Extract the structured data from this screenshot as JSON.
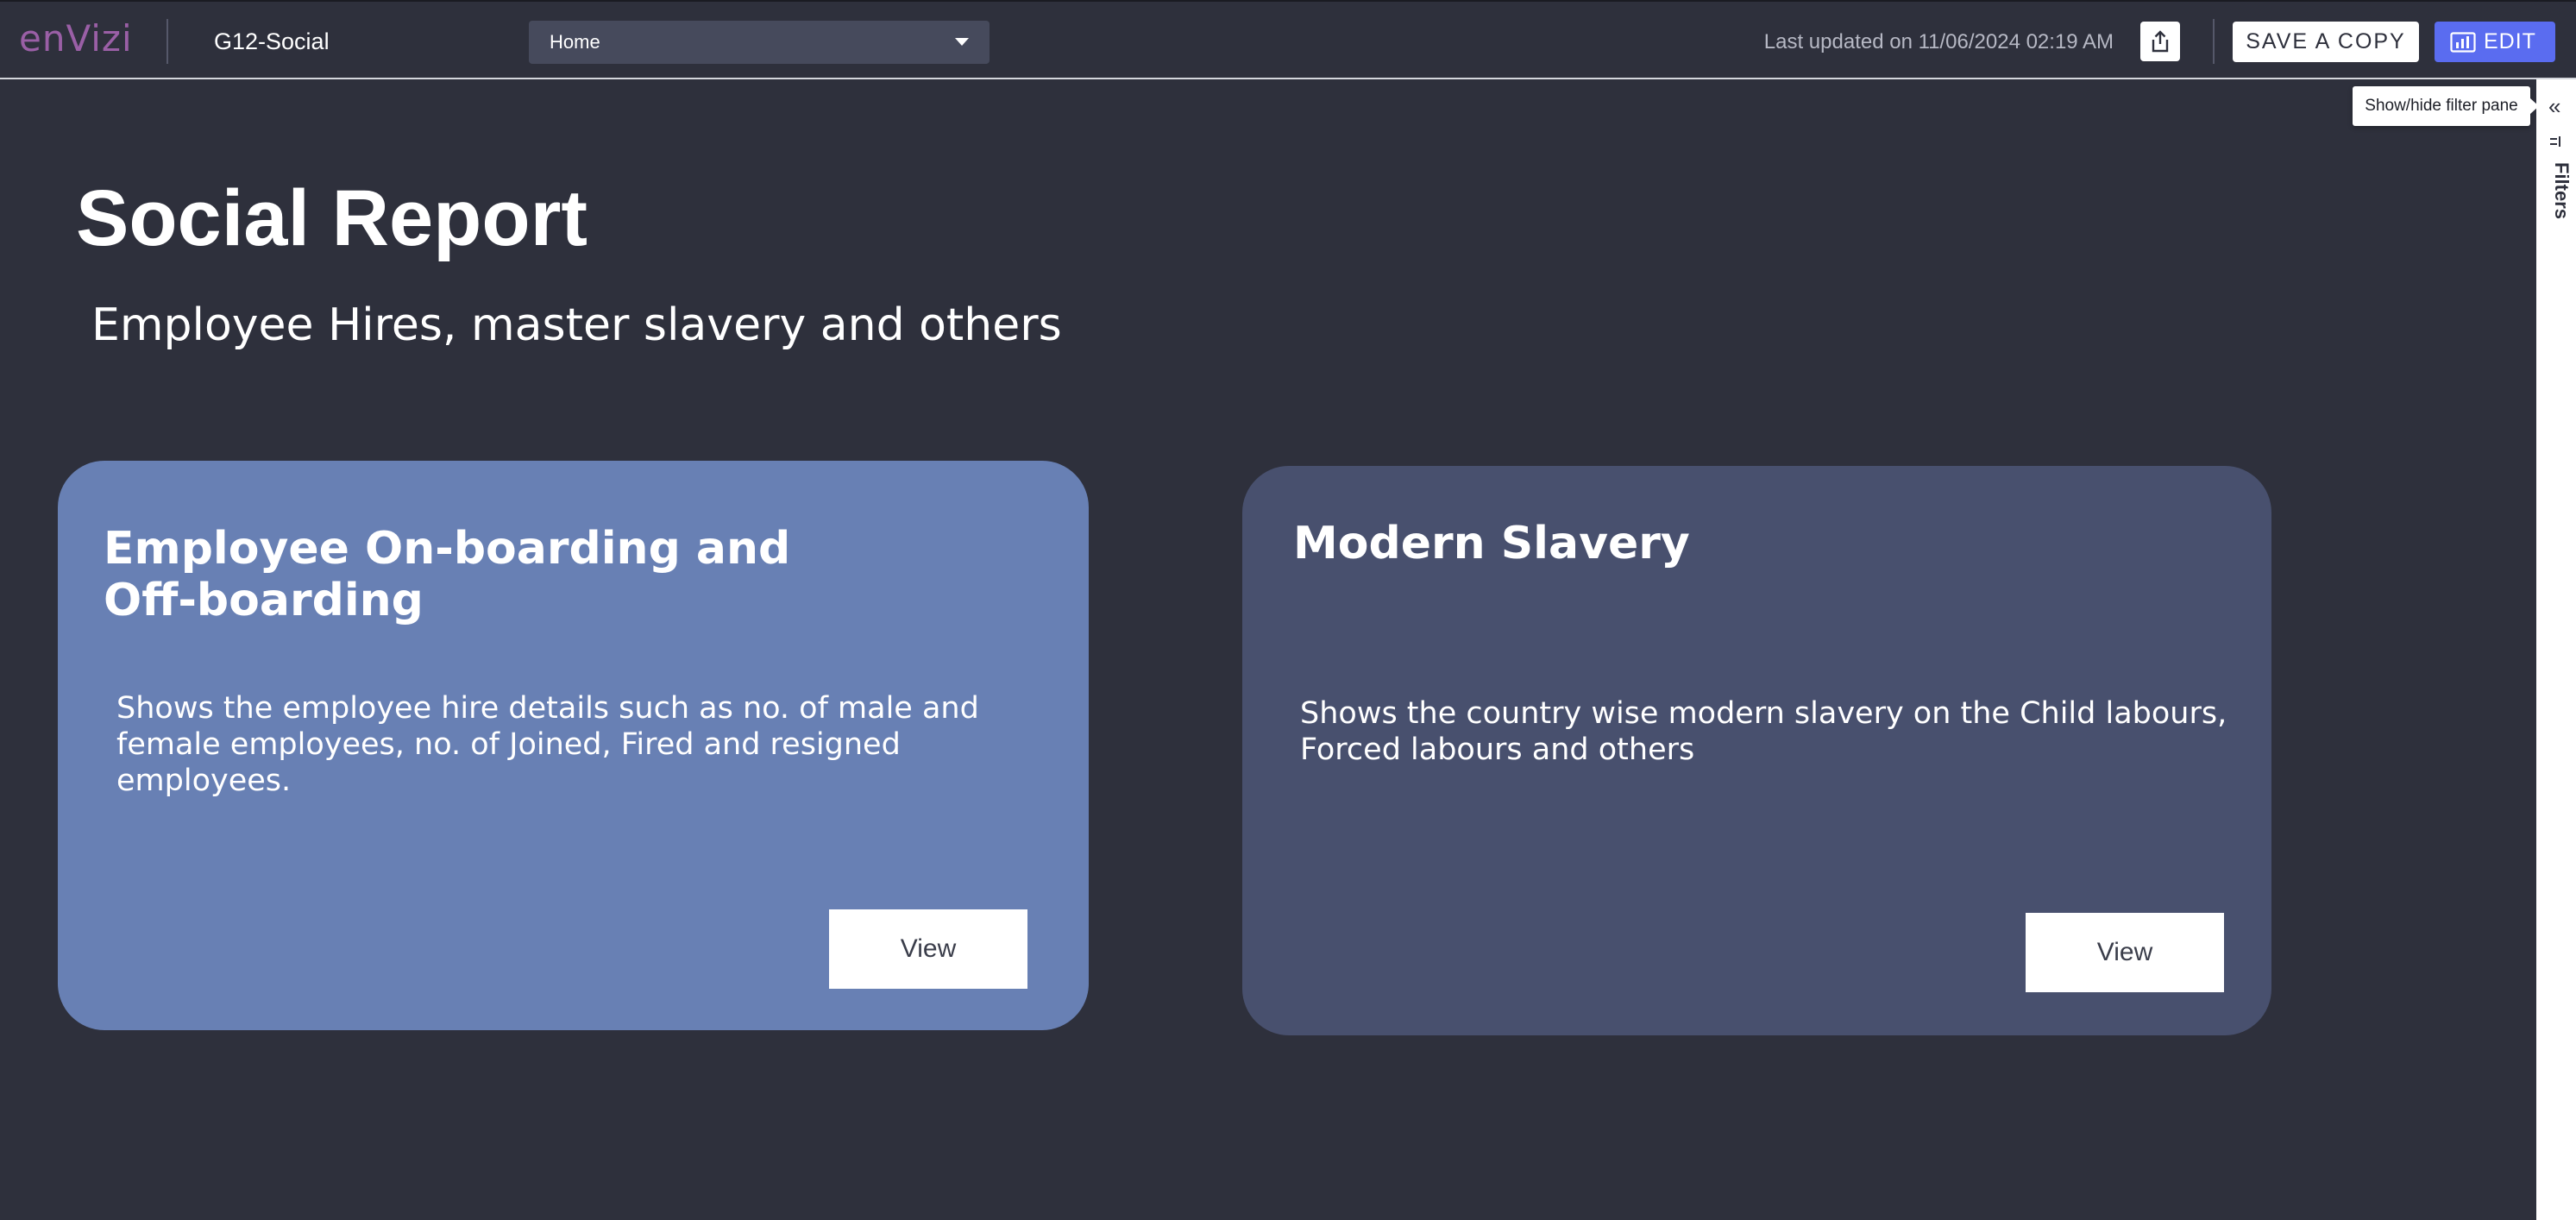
{
  "header": {
    "logo_text": "enVizi",
    "app_title": "G12-Social",
    "page_select": {
      "value": "Home"
    },
    "last_updated": "Last updated on 11/06/2024 02:19 AM",
    "save_copy_label": "SAVE A COPY",
    "edit_label": "EDIT"
  },
  "filter_pane": {
    "label": "Filters",
    "tooltip": "Show/hide filter pane",
    "collapse_glyph": "«"
  },
  "report": {
    "title": "Social Report",
    "subtitle": "Employee Hires, master slavery and others",
    "cards": [
      {
        "title": "Employee On-boarding and Off-boarding",
        "description": "Shows the employee hire details such as no. of male and female employees, no. of Joined, Fired and resigned employees.",
        "button_label": "View"
      },
      {
        "title": "Modern Slavery",
        "description": "Shows the country wise modern slavery on the Child labours, Forced labours and others",
        "button_label": "View"
      }
    ]
  },
  "colors": {
    "background": "#2e303c",
    "card_1": "#6880b4",
    "card_2": "#48506e",
    "edit_button": "#5a6cf0",
    "logo": "#9a5fa6"
  }
}
